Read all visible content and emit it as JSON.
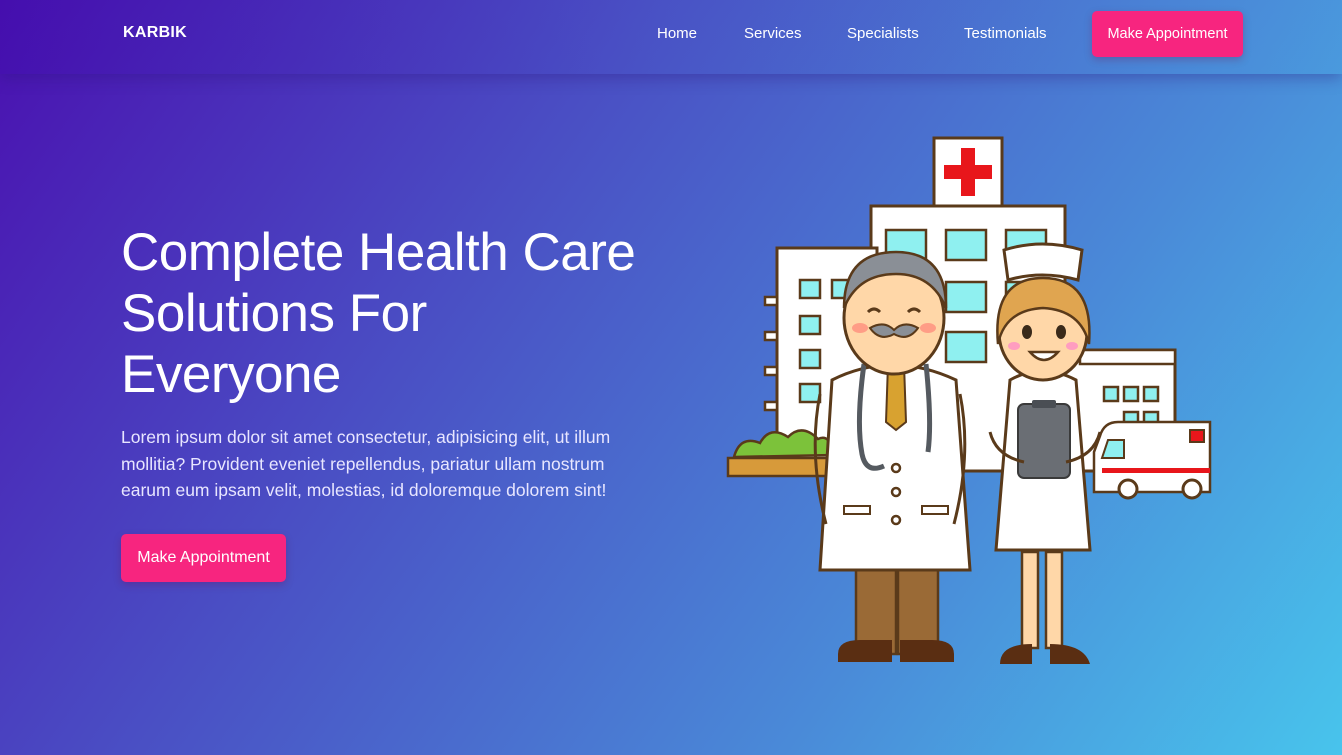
{
  "nav": {
    "brand": "KARBIK",
    "links": [
      "Home",
      "Services",
      "Specialists",
      "Testimonials"
    ],
    "cta_label": "Make Appointment"
  },
  "hero": {
    "title": "Complete Health Care Solutions For Everyone",
    "description": "Lorem ipsum dolor sit amet consectetur, adipisicing elit, ut illum mollitia? Provident eveniet repellendus, pariatur ullam nostrum earum eum ipsam velit, molestias, id doloremque dolorem sint!",
    "cta_label": "Make Appointment"
  },
  "colors": {
    "accent": "#f7257f",
    "gradient_start": "#4a10b0",
    "gradient_end": "#48c4ec"
  },
  "icons": {
    "illustration": "doctor-nurse-hospital-illustration"
  }
}
